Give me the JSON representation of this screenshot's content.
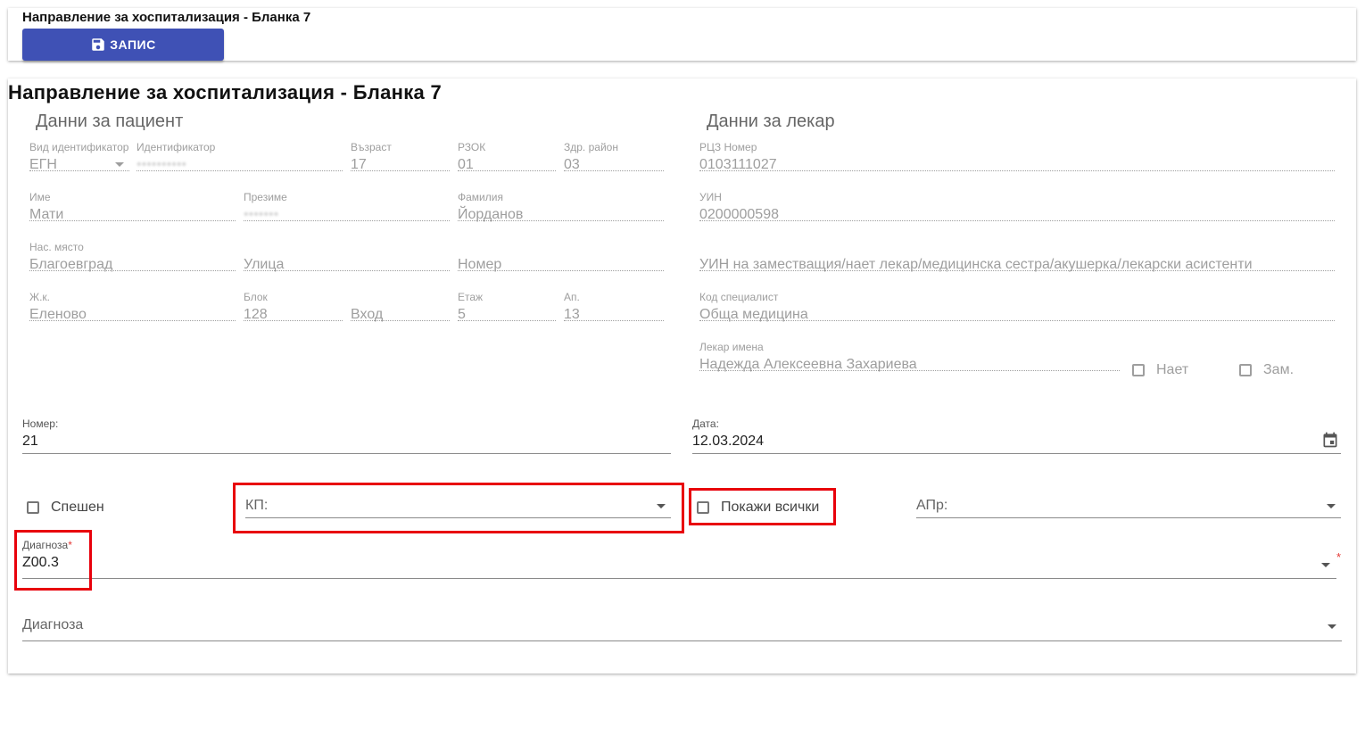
{
  "toolbar": {
    "title": "Направление за хоспитализация - Бланка 7",
    "save_label": "ЗАПИС"
  },
  "form": {
    "title": "Направление за хоспитализация - Бланка 7",
    "patient": {
      "section_title": "Данни за пациент",
      "id_type": {
        "label": "Вид идентификатор",
        "value": "ЕГН"
      },
      "identifier": {
        "label": "Идентификатор",
        "value": "••••••••••"
      },
      "age": {
        "label": "Възраст",
        "value": "17"
      },
      "rzok": {
        "label": "РЗОК",
        "value": "01"
      },
      "health_region": {
        "label": "Здр. район",
        "value": "03"
      },
      "first_name": {
        "label": "Име",
        "value": "Мати"
      },
      "middle_name": {
        "label": "Презиме",
        "value": "•••••••"
      },
      "last_name": {
        "label": "Фамилия",
        "value": "Йорданов"
      },
      "city": {
        "label": "Нас. място",
        "value": "Благоевград"
      },
      "street": {
        "placeholder": "Улица"
      },
      "number": {
        "placeholder": "Номер"
      },
      "district": {
        "label": "Ж.к.",
        "value": "Еленово"
      },
      "block": {
        "label": "Блок",
        "value": "128"
      },
      "entrance": {
        "placeholder": "Вход"
      },
      "floor": {
        "label": "Етаж",
        "value": "5"
      },
      "apartment": {
        "label": "Ап.",
        "value": "13"
      }
    },
    "doctor": {
      "section_title": "Данни за лекар",
      "rcz": {
        "label": "РЦЗ Номер",
        "value": "0103111027"
      },
      "uin": {
        "label": "УИН",
        "value": "0200000598"
      },
      "deputy_uin": {
        "placeholder": "УИН на заместващия/нает лекар/медицинска сестра/акушерка/лекарски асистенти"
      },
      "specialist_code": {
        "label": "Код специалист",
        "value": "Обща медицина"
      },
      "doctor_name": {
        "label": "Лекар имена",
        "value": "Надежда Алексеевна Захариева"
      },
      "hired_label": "Нает",
      "deputy_label": "Зам."
    },
    "number": {
      "label": "Номер:",
      "value": "21"
    },
    "date": {
      "label": "Дата:",
      "value": "12.03.2024"
    },
    "urgent_label": "Спешен",
    "kp": {
      "placeholder": "КП:"
    },
    "show_all_label": "Покажи всички",
    "apr": {
      "placeholder": "АПр:"
    },
    "diagnosis_main": {
      "label": "Диагноза",
      "required_mark": "*",
      "value": "Z00.3"
    },
    "diagnosis_secondary": {
      "placeholder": "Диагноза"
    }
  },
  "colors": {
    "primary": "#3f51b5",
    "highlight": "#e8000b",
    "required": "#e53935",
    "muted": "#9e9e9e"
  }
}
